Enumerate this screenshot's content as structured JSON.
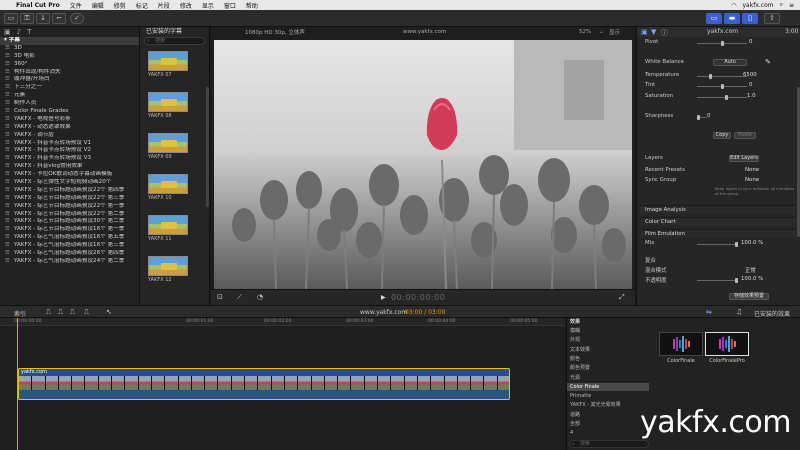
{
  "menubar": {
    "items": [
      "Final Cut Pro",
      "文件",
      "编辑",
      "修剪",
      "标记",
      "片段",
      "修改",
      "显示",
      "窗口",
      "帮助"
    ],
    "right_site": "yakfx.com"
  },
  "libraries": {
    "rows": [
      {
        "label": "字幕",
        "head": true
      },
      {
        "label": "3D"
      },
      {
        "label": "3D 电影"
      },
      {
        "label": "360°"
      },
      {
        "label": "构件出现/构件消失"
      },
      {
        "label": "缓冲器/开场白"
      },
      {
        "label": "下三分之一"
      },
      {
        "label": "元素"
      },
      {
        "label": "制作人员"
      },
      {
        "label": "Color Finale Grades"
      },
      {
        "label": "YAKFX - 电视信号彩条"
      },
      {
        "label": "YAKFX - 动态遮罩效果"
      },
      {
        "label": "YAKFX - 调节层"
      },
      {
        "label": "YAKFX - 抖音卡点转场预设 V1"
      },
      {
        "label": "YAKFX - 抖音卡点转场预设 V2"
      },
      {
        "label": "YAKFX - 抖音卡点转场预设 V3"
      },
      {
        "label": "YAKFX - 抖音vlog常用效果"
      },
      {
        "label": "YAKFX - 卡拉OK歌词动态字幕动画模板"
      },
      {
        "label": "YAKFX - 综艺弹性文字短视频动画20个"
      },
      {
        "label": "YAKFX - 综艺节目标题动画预设22个 第四季"
      },
      {
        "label": "YAKFX - 综艺节目标题动画预设22个 第三季"
      },
      {
        "label": "YAKFX - 综艺节目标题动画预设22个 第一季"
      },
      {
        "label": "YAKFX - 综艺节目标题动画预设22个 第二季"
      },
      {
        "label": "YAKFX - 综艺节目标题动画预设30个 第二季"
      },
      {
        "label": "YAKFX - 综艺节目标题动画预设16个 第一季"
      },
      {
        "label": "YAKFX - 综艺气泡标题动画预设16个 第五季"
      },
      {
        "label": "YAKFX - 综艺气泡标题动画预设16个 第三季"
      },
      {
        "label": "YAKFX - 综艺气泡标题动画预设26个 第四季"
      },
      {
        "label": "YAKFX - 综艺气泡标题动画预设24个 第二季"
      }
    ]
  },
  "browser": {
    "title": "已安装的字幕",
    "search_placeholder": "搜索",
    "clips": [
      "YAKFX 07",
      "YAKFX 08",
      "YAKFX 09",
      "YAKFX 10",
      "YAKFX 11",
      "YAKFX 12"
    ]
  },
  "viewer": {
    "format": "1080p HD 30p, 立体声",
    "url": "www.yakfx.com",
    "zoom": "52%",
    "view_label": "显示",
    "timecode": "00:00:00:00"
  },
  "inspector": {
    "top_site": "yakfx.com",
    "top_value": "3:00",
    "pivot": {
      "label": "Pivot",
      "value": "0"
    },
    "white_balance": {
      "label": "White Balance",
      "value": "Auto"
    },
    "temperature": {
      "label": "Temperature",
      "value": "6500"
    },
    "tint": {
      "label": "Tint",
      "value": "0"
    },
    "saturation": {
      "label": "Saturation",
      "value": "1.0"
    },
    "sharpness": {
      "label": "Sharpness",
      "value": "0"
    },
    "copy_label": "Copy",
    "paste_label": "Paste",
    "layers_label": "Layers",
    "edit_layers_label": "Edit Layers",
    "recent_presets": {
      "label": "Recent Presets",
      "value": "None"
    },
    "sync_group": {
      "label": "Sync Group",
      "value": "None"
    },
    "sync_note": "Keep layers in sync between all members of the group.",
    "sections": [
      "Image Analysis",
      "Color Chart",
      "Film Emulation"
    ],
    "mix": {
      "label": "Mix",
      "value": "100.0 %"
    },
    "composite_label": "复合",
    "blend_mode": {
      "label": "混合模式",
      "value": "正常"
    },
    "opacity": {
      "label": "不透明度",
      "value": "100.0 %"
    },
    "save_preset_label": "存储效果预置"
  },
  "timeline_bar": {
    "index_label": "索引",
    "project": "www.yakfx.com",
    "time": "03:00 / 03:00",
    "effects_title": "已安装的效果"
  },
  "timeline": {
    "ticks": [
      "00:00:00:00",
      "00:00:01:00",
      "00:00:02:00",
      "00:00:03:00",
      "00:00:04:00",
      "00:00:05:00"
    ],
    "clip_label": "yakfx.com"
  },
  "effects": {
    "header": "效果",
    "categories": [
      "模糊",
      "外观",
      "文本效果",
      "颜色",
      "颜色预置",
      "光源",
      "Color Finale",
      "Primatte",
      "YAKFX - 其光光晕效果",
      "道路",
      "全部",
      "4"
    ],
    "selected_category": "Color Finale",
    "items": [
      {
        "label": "ColorFinale",
        "selected": false
      },
      {
        "label": "ColorFinalePro",
        "selected": true
      }
    ],
    "search_placeholder": "搜索"
  },
  "watermark": "yakfx.com",
  "colors": {
    "accent": "#3a5fcf",
    "playhead": "#e0b000",
    "clip_border": "#f0c000",
    "tulip": "#d23a55"
  }
}
